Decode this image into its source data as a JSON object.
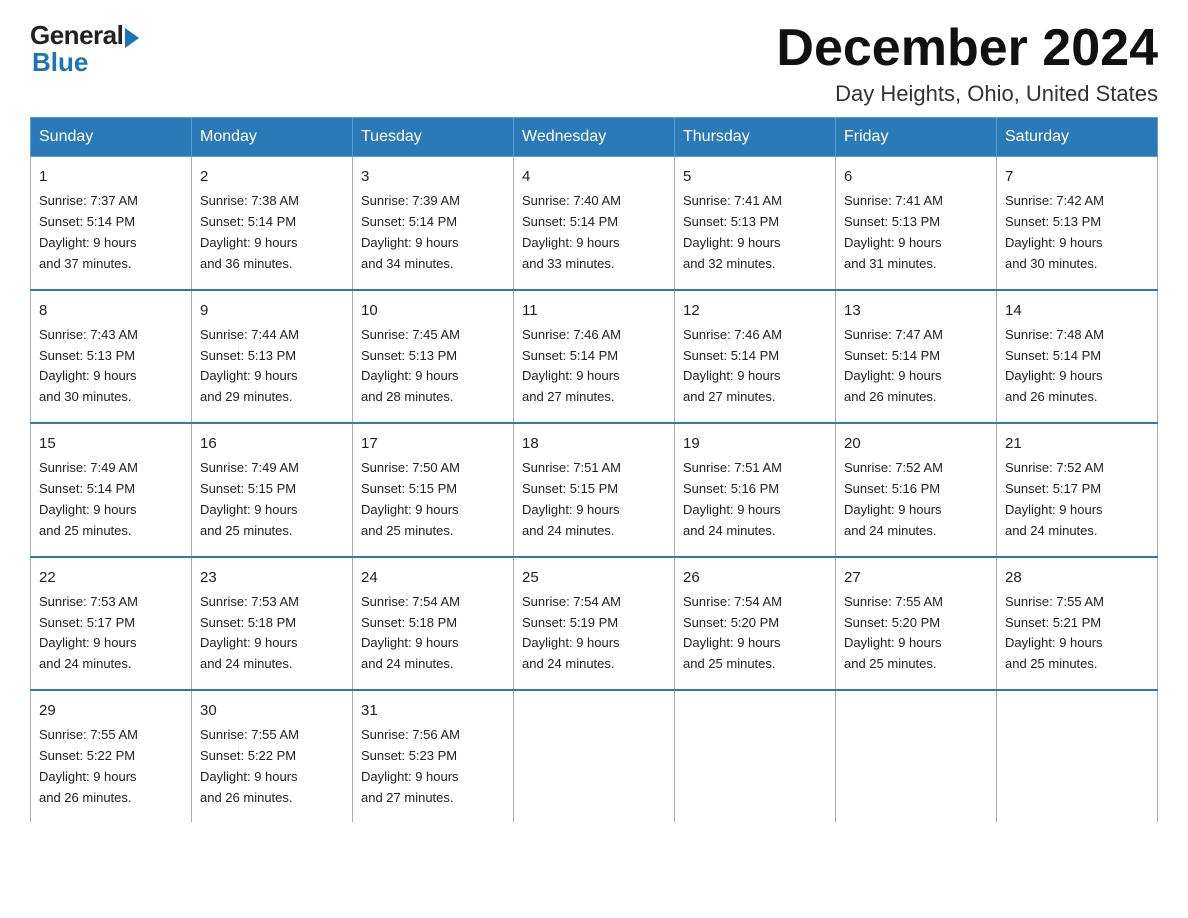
{
  "logo": {
    "general": "General",
    "blue": "Blue"
  },
  "title": {
    "month": "December 2024",
    "location": "Day Heights, Ohio, United States"
  },
  "days_header": [
    "Sunday",
    "Monday",
    "Tuesday",
    "Wednesday",
    "Thursday",
    "Friday",
    "Saturday"
  ],
  "weeks": [
    [
      {
        "day": "1",
        "sunrise": "7:37 AM",
        "sunset": "5:14 PM",
        "daylight": "9 hours and 37 minutes."
      },
      {
        "day": "2",
        "sunrise": "7:38 AM",
        "sunset": "5:14 PM",
        "daylight": "9 hours and 36 minutes."
      },
      {
        "day": "3",
        "sunrise": "7:39 AM",
        "sunset": "5:14 PM",
        "daylight": "9 hours and 34 minutes."
      },
      {
        "day": "4",
        "sunrise": "7:40 AM",
        "sunset": "5:14 PM",
        "daylight": "9 hours and 33 minutes."
      },
      {
        "day": "5",
        "sunrise": "7:41 AM",
        "sunset": "5:13 PM",
        "daylight": "9 hours and 32 minutes."
      },
      {
        "day": "6",
        "sunrise": "7:41 AM",
        "sunset": "5:13 PM",
        "daylight": "9 hours and 31 minutes."
      },
      {
        "day": "7",
        "sunrise": "7:42 AM",
        "sunset": "5:13 PM",
        "daylight": "9 hours and 30 minutes."
      }
    ],
    [
      {
        "day": "8",
        "sunrise": "7:43 AM",
        "sunset": "5:13 PM",
        "daylight": "9 hours and 30 minutes."
      },
      {
        "day": "9",
        "sunrise": "7:44 AM",
        "sunset": "5:13 PM",
        "daylight": "9 hours and 29 minutes."
      },
      {
        "day": "10",
        "sunrise": "7:45 AM",
        "sunset": "5:13 PM",
        "daylight": "9 hours and 28 minutes."
      },
      {
        "day": "11",
        "sunrise": "7:46 AM",
        "sunset": "5:14 PM",
        "daylight": "9 hours and 27 minutes."
      },
      {
        "day": "12",
        "sunrise": "7:46 AM",
        "sunset": "5:14 PM",
        "daylight": "9 hours and 27 minutes."
      },
      {
        "day": "13",
        "sunrise": "7:47 AM",
        "sunset": "5:14 PM",
        "daylight": "9 hours and 26 minutes."
      },
      {
        "day": "14",
        "sunrise": "7:48 AM",
        "sunset": "5:14 PM",
        "daylight": "9 hours and 26 minutes."
      }
    ],
    [
      {
        "day": "15",
        "sunrise": "7:49 AM",
        "sunset": "5:14 PM",
        "daylight": "9 hours and 25 minutes."
      },
      {
        "day": "16",
        "sunrise": "7:49 AM",
        "sunset": "5:15 PM",
        "daylight": "9 hours and 25 minutes."
      },
      {
        "day": "17",
        "sunrise": "7:50 AM",
        "sunset": "5:15 PM",
        "daylight": "9 hours and 25 minutes."
      },
      {
        "day": "18",
        "sunrise": "7:51 AM",
        "sunset": "5:15 PM",
        "daylight": "9 hours and 24 minutes."
      },
      {
        "day": "19",
        "sunrise": "7:51 AM",
        "sunset": "5:16 PM",
        "daylight": "9 hours and 24 minutes."
      },
      {
        "day": "20",
        "sunrise": "7:52 AM",
        "sunset": "5:16 PM",
        "daylight": "9 hours and 24 minutes."
      },
      {
        "day": "21",
        "sunrise": "7:52 AM",
        "sunset": "5:17 PM",
        "daylight": "9 hours and 24 minutes."
      }
    ],
    [
      {
        "day": "22",
        "sunrise": "7:53 AM",
        "sunset": "5:17 PM",
        "daylight": "9 hours and 24 minutes."
      },
      {
        "day": "23",
        "sunrise": "7:53 AM",
        "sunset": "5:18 PM",
        "daylight": "9 hours and 24 minutes."
      },
      {
        "day": "24",
        "sunrise": "7:54 AM",
        "sunset": "5:18 PM",
        "daylight": "9 hours and 24 minutes."
      },
      {
        "day": "25",
        "sunrise": "7:54 AM",
        "sunset": "5:19 PM",
        "daylight": "9 hours and 24 minutes."
      },
      {
        "day": "26",
        "sunrise": "7:54 AM",
        "sunset": "5:20 PM",
        "daylight": "9 hours and 25 minutes."
      },
      {
        "day": "27",
        "sunrise": "7:55 AM",
        "sunset": "5:20 PM",
        "daylight": "9 hours and 25 minutes."
      },
      {
        "day": "28",
        "sunrise": "7:55 AM",
        "sunset": "5:21 PM",
        "daylight": "9 hours and 25 minutes."
      }
    ],
    [
      {
        "day": "29",
        "sunrise": "7:55 AM",
        "sunset": "5:22 PM",
        "daylight": "9 hours and 26 minutes."
      },
      {
        "day": "30",
        "sunrise": "7:55 AM",
        "sunset": "5:22 PM",
        "daylight": "9 hours and 26 minutes."
      },
      {
        "day": "31",
        "sunrise": "7:56 AM",
        "sunset": "5:23 PM",
        "daylight": "9 hours and 27 minutes."
      },
      null,
      null,
      null,
      null
    ]
  ],
  "labels": {
    "sunrise": "Sunrise:",
    "sunset": "Sunset:",
    "daylight": "Daylight:"
  }
}
